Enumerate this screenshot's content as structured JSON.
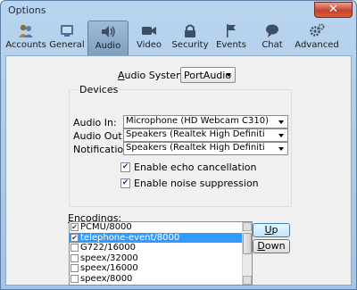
{
  "window": {
    "title": "Options",
    "close_symbol": "✕"
  },
  "toolbar": {
    "items": [
      {
        "label": "Accounts",
        "icon": "accounts-icon",
        "active": false
      },
      {
        "label": "General",
        "icon": "general-icon",
        "active": false
      },
      {
        "label": "Audio",
        "icon": "speaker-icon",
        "active": true
      },
      {
        "label": "Video",
        "icon": "video-camera-icon",
        "active": false
      },
      {
        "label": "Security",
        "icon": "lock-icon",
        "active": false
      },
      {
        "label": "Events",
        "icon": "flag-icon",
        "active": false
      },
      {
        "label": "Chat",
        "icon": "chat-bubble-icon",
        "active": false
      },
      {
        "label": "Advanced",
        "icon": "gears-icon",
        "active": false
      }
    ]
  },
  "audio_system": {
    "label_pre": "A",
    "label_post": "udio System:",
    "value": "PortAudio"
  },
  "devices": {
    "title": "Devices",
    "audio_in": {
      "label": "Audio In:",
      "value": "Microphone (HD Webcam C310)"
    },
    "audio_out": {
      "label": "Audio Out:",
      "value": "Speakers (Realtek High Definiti"
    },
    "notifications": {
      "label": "Notifications:",
      "value": "Speakers (Realtek High Definiti"
    },
    "echo_cancellation": {
      "label": "Enable echo cancellation",
      "checked": true,
      "check_glyph": "✔"
    },
    "noise_suppression": {
      "label": "Enable noise suppression",
      "checked": true,
      "check_glyph": "✔"
    }
  },
  "encodings": {
    "label_pre": "E",
    "label_post": "ncodings:",
    "items": [
      {
        "name": "PCMU/8000",
        "checked": true,
        "selected": false,
        "check_glyph": "✔"
      },
      {
        "name": "telephone-event/8000",
        "checked": true,
        "selected": true,
        "check_glyph": "✔"
      },
      {
        "name": "G722/16000",
        "checked": false,
        "selected": false,
        "check_glyph": ""
      },
      {
        "name": "speex/32000",
        "checked": false,
        "selected": false,
        "check_glyph": ""
      },
      {
        "name": "speex/16000",
        "checked": false,
        "selected": false,
        "check_glyph": ""
      },
      {
        "name": "speex/8000",
        "checked": false,
        "selected": false,
        "check_glyph": ""
      }
    ],
    "up_pre": "U",
    "up_post": "p",
    "down_pre": "D",
    "down_post": "own"
  },
  "colors": {
    "selection": "#3399ff",
    "titlebar": "#b9d4ee",
    "close": "#c7412a"
  }
}
